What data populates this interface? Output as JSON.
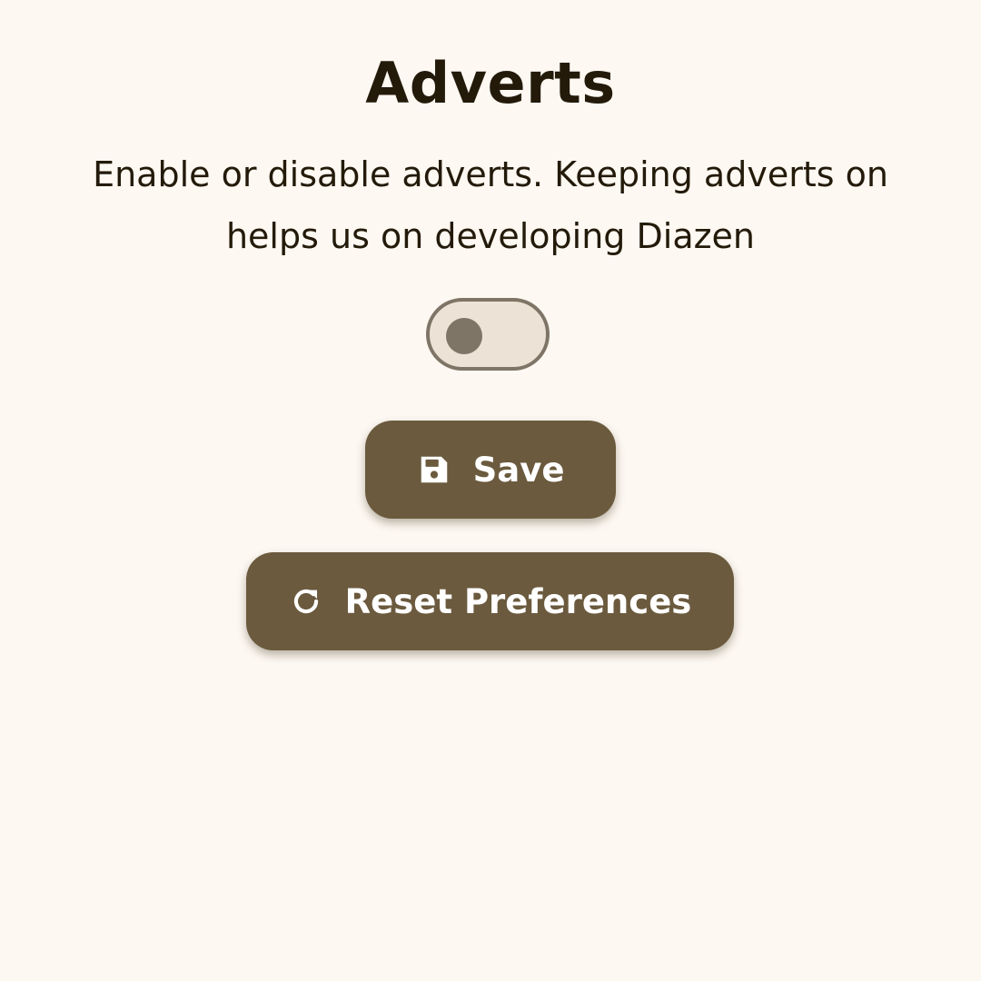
{
  "screen": {
    "title": "Adverts",
    "description_line1": "Enable or disable adverts. Keeping adverts on",
    "description_line2": "helps us on developing Diazen"
  },
  "adverts_toggle": {
    "state": "off",
    "icon": "toggle-switch"
  },
  "actions": {
    "save_label": "Save",
    "save_icon": "floppy-disk-icon",
    "reset_label": "Reset Preferences",
    "reset_icon": "refresh-icon"
  },
  "colors": {
    "background": "#fdf8f2",
    "text": "#231a0a",
    "button": "#6b5a3e",
    "button_text": "#ffffff",
    "toggle_track": "#ece2d6",
    "toggle_outline": "#7f7566"
  }
}
